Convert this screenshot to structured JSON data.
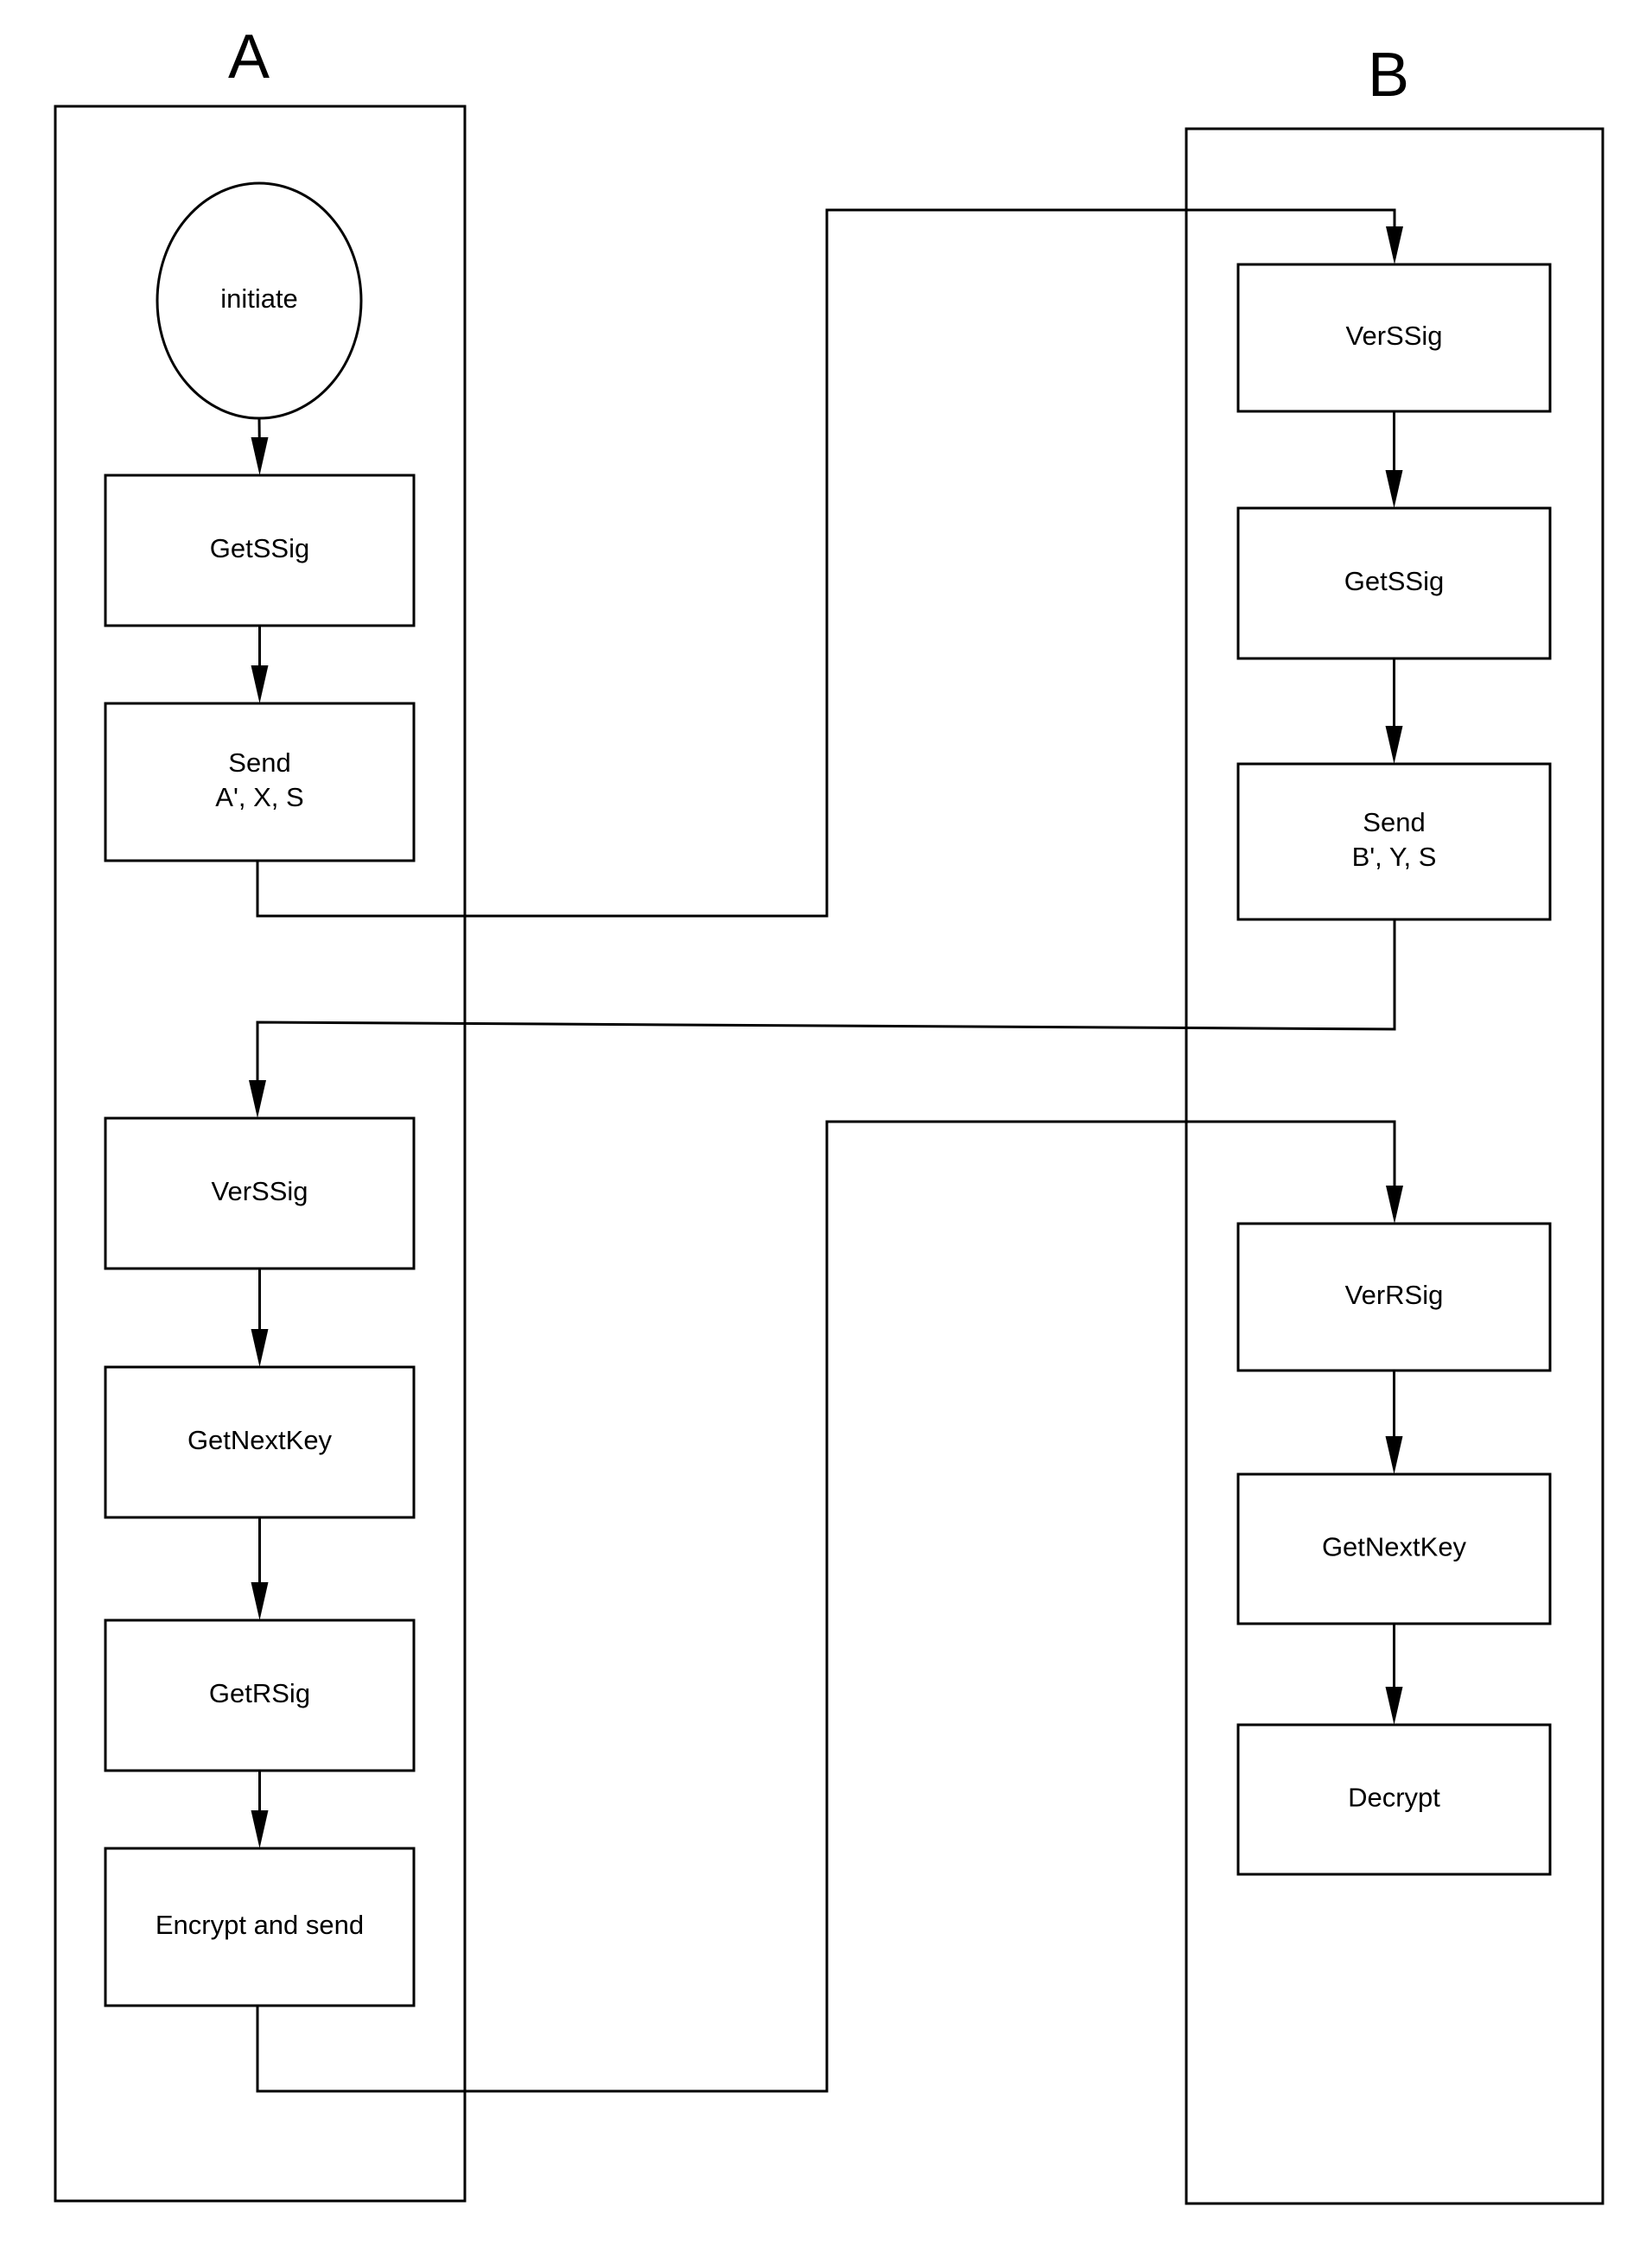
{
  "diagram": {
    "type": "swimlane-flowchart",
    "lanes": [
      {
        "id": "A",
        "title": "A"
      },
      {
        "id": "B",
        "title": "B"
      }
    ],
    "nodes": [
      {
        "id": "a_initiate",
        "lane": "A",
        "shape": "ellipse",
        "label_lines": [
          "initiate"
        ]
      },
      {
        "id": "a_getssig",
        "lane": "A",
        "shape": "rect",
        "label_lines": [
          "GetSSig"
        ]
      },
      {
        "id": "a_send",
        "lane": "A",
        "shape": "rect",
        "label_lines": [
          "Send",
          "A', X, S"
        ]
      },
      {
        "id": "a_verssig",
        "lane": "A",
        "shape": "rect",
        "label_lines": [
          "VerSSig"
        ]
      },
      {
        "id": "a_getnextkey",
        "lane": "A",
        "shape": "rect",
        "label_lines": [
          "GetNextKey"
        ]
      },
      {
        "id": "a_getrsig",
        "lane": "A",
        "shape": "rect",
        "label_lines": [
          "GetRSig"
        ]
      },
      {
        "id": "a_encrypt",
        "lane": "A",
        "shape": "rect",
        "label_lines": [
          "Encrypt and send"
        ]
      },
      {
        "id": "b_verssig",
        "lane": "B",
        "shape": "rect",
        "label_lines": [
          "VerSSig"
        ]
      },
      {
        "id": "b_getssig",
        "lane": "B",
        "shape": "rect",
        "label_lines": [
          "GetSSig"
        ]
      },
      {
        "id": "b_send",
        "lane": "B",
        "shape": "rect",
        "label_lines": [
          "Send",
          "B', Y, S"
        ]
      },
      {
        "id": "b_verrsig",
        "lane": "B",
        "shape": "rect",
        "label_lines": [
          "VerRSig"
        ]
      },
      {
        "id": "b_getnextkey",
        "lane": "B",
        "shape": "rect",
        "label_lines": [
          "GetNextKey"
        ]
      },
      {
        "id": "b_decrypt",
        "lane": "B",
        "shape": "rect",
        "label_lines": [
          "Decrypt"
        ]
      }
    ],
    "edges": [
      {
        "from": "a_initiate",
        "to": "a_getssig"
      },
      {
        "from": "a_getssig",
        "to": "a_send"
      },
      {
        "from": "a_send",
        "to": "b_verssig"
      },
      {
        "from": "b_verssig",
        "to": "b_getssig"
      },
      {
        "from": "b_getssig",
        "to": "b_send"
      },
      {
        "from": "b_send",
        "to": "a_verssig"
      },
      {
        "from": "a_verssig",
        "to": "a_getnextkey"
      },
      {
        "from": "a_getnextkey",
        "to": "a_getrsig"
      },
      {
        "from": "a_getrsig",
        "to": "a_encrypt"
      },
      {
        "from": "a_encrypt",
        "to": "b_verrsig"
      },
      {
        "from": "b_verrsig",
        "to": "b_getnextkey"
      },
      {
        "from": "b_getnextkey",
        "to": "b_decrypt"
      }
    ]
  }
}
